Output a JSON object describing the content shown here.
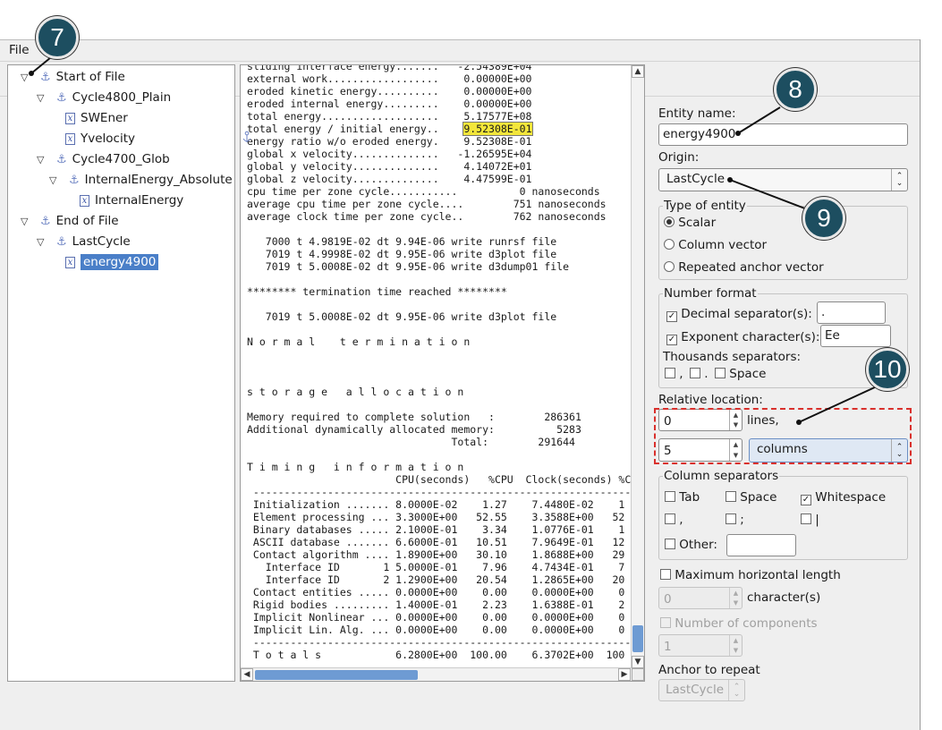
{
  "menu": {
    "file": "File"
  },
  "tree": [
    {
      "label": "Start of File",
      "icon": "anchor-icon"
    },
    {
      "label": "Cycle4800_Plain",
      "icon": "anchor-icon"
    },
    {
      "label": "SWEner",
      "icon": "variable-icon"
    },
    {
      "label": "Yvelocity",
      "icon": "variable-icon"
    },
    {
      "label": "Cycle4700_Glob",
      "icon": "anchor-icon"
    },
    {
      "label": "InternalEnergy_Absolute",
      "icon": "anchor-icon"
    },
    {
      "label": "InternalEnergy",
      "icon": "variable-icon"
    },
    {
      "label": "End of File",
      "icon": "anchor-icon"
    },
    {
      "label": "LastCycle",
      "icon": "anchor-icon"
    },
    {
      "label": "energy4900",
      "icon": "variable-icon"
    }
  ],
  "text_before": "sliding interface energy.......   -2.54389E+04\nexternal work..................    0.00000E+00\neroded kinetic energy..........    0.00000E+00\neroded internal energy.........    0.00000E+00\ntotal energy...................    5.17577E+08\ntotal energy / initial energy..    ",
  "text_highlight": "9.52308E-01",
  "text_after": "\nenergy ratio w/o eroded energy.    9.52308E-01\nglobal x velocity..............   -1.26595E+04\nglobal y velocity..............    4.14072E+01\nglobal z velocity..............    4.47599E-01\ncpu time per zone cycle...........          0 nanoseconds\naverage cpu time per zone cycle....        751 nanoseconds\naverage clock time per zone cycle..        762 nanoseconds\n\n   7000 t 4.9819E-02 dt 9.94E-06 write runrsf file\n   7019 t 4.9998E-02 dt 9.95E-06 write d3plot file\n   7019 t 5.0008E-02 dt 9.95E-06 write d3dump01 file\n\n******** termination time reached ********\n\n   7019 t 5.0008E-02 dt 9.95E-06 write d3plot file\n\nN o r m a l    t e r m i n a t i o n\n\n\n\ns t o r a g e   a l l o c a t i o n\n\nMemory required to complete solution   :        286361\nAdditional dynamically allocated memory:          5283\n                                 Total:        291644\n\nT i m i n g   i n f o r m a t i o n\n                        CPU(seconds)   %CPU  Clock(seconds) %C\n ----------------------------------------------------------------\n Initialization ....... 8.0000E-02    1.27    7.4480E-02    1\n Element processing ... 3.3000E+00   52.55    3.3588E+00   52\n Binary databases ..... 2.1000E-01    3.34    1.0776E-01    1\n ASCII database ....... 6.6000E-01   10.51    7.9649E-01   12\n Contact algorithm .... 1.8900E+00   30.10    1.8688E+00   29\n   Interface ID       1 5.0000E-01    7.96    4.7434E-01    7\n   Interface ID       2 1.2900E+00   20.54    1.2865E+00   20\n Contact entities ..... 0.0000E+00    0.00    0.0000E+00    0\n Rigid bodies ......... 1.4000E-01    2.23    1.6388E-01    2\n Implicit Nonlinear ... 0.0000E+00    0.00    0.0000E+00    0\n Implicit Lin. Alg. ... 0.0000E+00    0.00    0.0000E+00    0\n ----------------------------------------------------------------\n T o t a l s            6.2800E+00  100.00    6.3702E+00  100",
  "panel": {
    "entity_name_label": "Entity name:",
    "entity_name_value": "energy4900",
    "origin_label": "Origin:",
    "origin_value": "LastCycle",
    "type_title": "Type of entity",
    "type_scalar": "Scalar",
    "type_column": "Column vector",
    "type_repeated": "Repeated anchor vector",
    "number_format_title": "Number format",
    "decimal_label": "Decimal separator(s):",
    "decimal_value": ".",
    "exponent_label": "Exponent character(s):",
    "exponent_value": "Ee",
    "thousands_label": "Thousands separators:",
    "thousands_comma": ",",
    "thousands_dot": ".",
    "thousands_space": "Space",
    "relative_label": "Relative location:",
    "lines_value": "0",
    "lines_label": "lines,",
    "columns_value": "5",
    "columns_unit": "columns",
    "col_sep_title": "Column separators",
    "sep_tab": "Tab",
    "sep_space": "Space",
    "sep_whitespace": "Whitespace",
    "sep_comma": ",",
    "sep_semicolon": ";",
    "sep_pipe": "|",
    "sep_other": "Other:",
    "max_len_label": "Maximum horizontal length",
    "max_len_value": "0",
    "max_len_unit": "character(s)",
    "num_components_label": "Number of components",
    "num_components_value": "1",
    "anchor_repeat_label": "Anchor to repeat",
    "anchor_repeat_value": "LastCycle"
  },
  "callouts": {
    "c7": "7",
    "c8": "8",
    "c9": "9",
    "c10": "10"
  },
  "colors": {
    "callout": "#1d4e60",
    "highlight": "#f3e63a",
    "selection": "#4a7fc8",
    "dashed_box": "#d9302c"
  }
}
